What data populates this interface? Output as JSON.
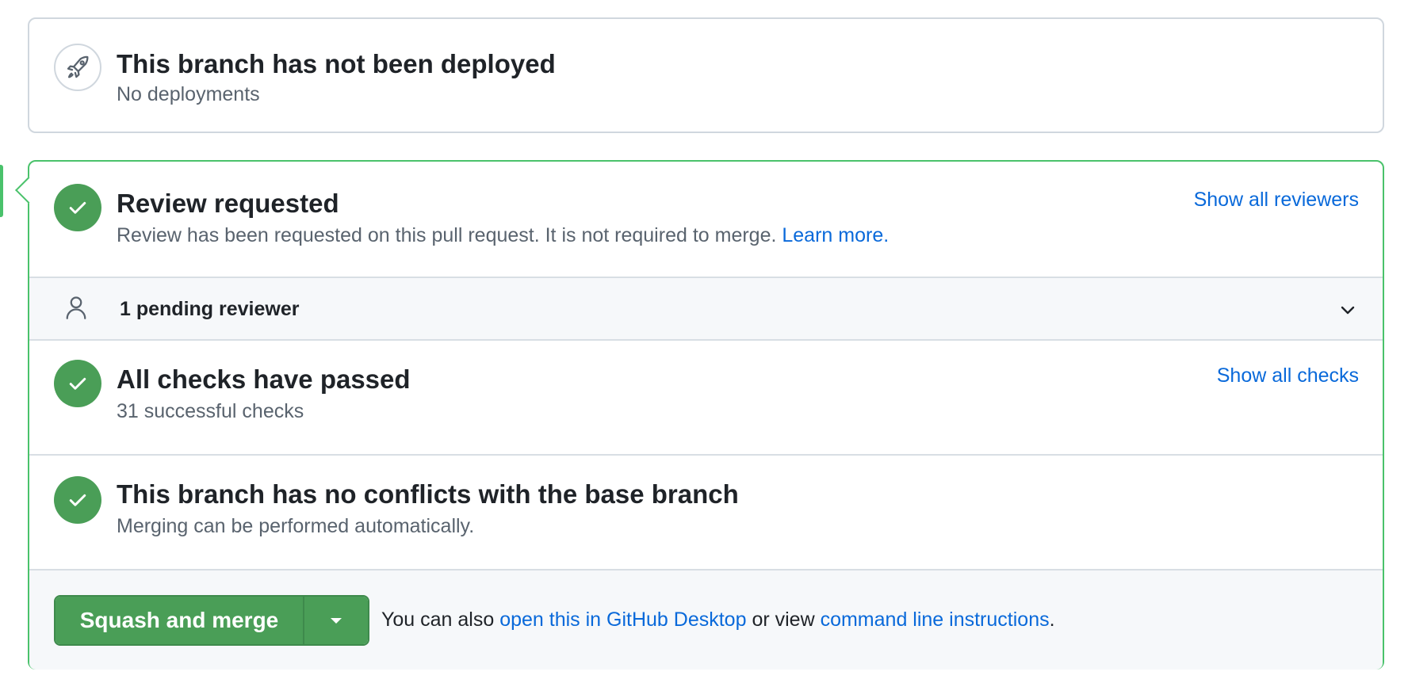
{
  "deployment": {
    "title": "This branch has not been deployed",
    "subtitle": "No deployments",
    "icon": "rocket-icon"
  },
  "review": {
    "title": "Review requested",
    "subtitle": "Review has been requested on this pull request. It is not required to merge.",
    "learn_more": "Learn more.",
    "show_all": "Show all reviewers"
  },
  "pending": {
    "label": "1 pending reviewer"
  },
  "checks": {
    "title": "All checks have passed",
    "subtitle": "31 successful checks",
    "show_all": "Show all checks"
  },
  "conflicts": {
    "title": "This branch has no conflicts with the base branch",
    "subtitle": "Merging can be performed automatically."
  },
  "actions": {
    "merge_button": "Squash and merge",
    "note_prefix": "You can also",
    "desktop_link": "open this in GitHub Desktop",
    "note_middle": "or view",
    "cli_link": "command line instructions",
    "note_suffix": "."
  },
  "colors": {
    "success": "#4a9e57",
    "border_success": "#4ac26b",
    "link": "#0969da",
    "muted": "#59636e"
  }
}
